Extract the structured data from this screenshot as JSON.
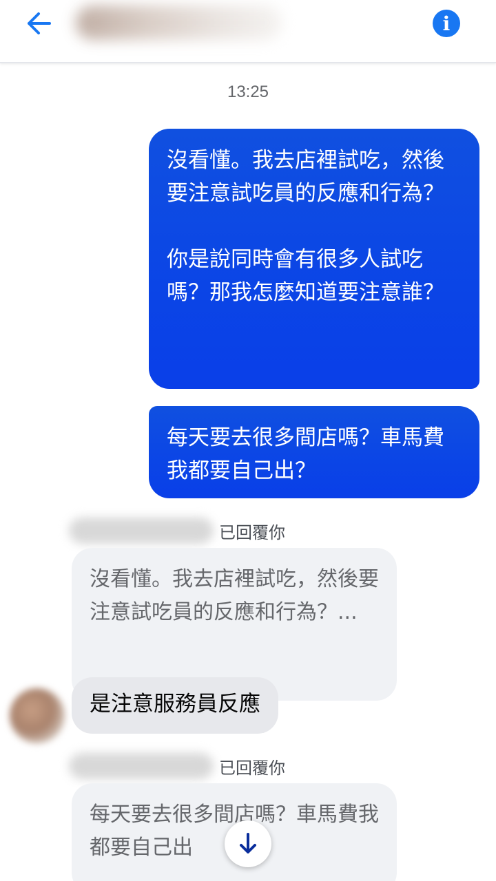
{
  "header": {
    "back_icon": "arrow-left-icon",
    "info_icon": "info-icon",
    "info_glyph": "i",
    "accent_color": "#1877f2"
  },
  "conversation": {
    "timestamp": "13:25",
    "outgoing": [
      {
        "text": "沒看懂。我去店裡試吃，然後要注意試吃員的反應和行為？\n\n你是說同時會有很多人試吃嗎？那我怎麼知道要注意誰？"
      },
      {
        "text": "每天要去很多間店嗎？車馬費我都要自己出？"
      }
    ],
    "replies": [
      {
        "label": "已回覆你",
        "quoted": "沒看懂。我去店裡試吃，然後要注意試吃員的反應和行為？...",
        "reply": "是注意服務員反應"
      },
      {
        "label": "已回覆你",
        "quoted": "每天要去很多間店嗎？車馬費我都要自己出"
      }
    ],
    "scroll_icon": "arrow-down-icon",
    "outgoing_color": "#0b45e6",
    "incoming_color": "#e7e8ec"
  }
}
